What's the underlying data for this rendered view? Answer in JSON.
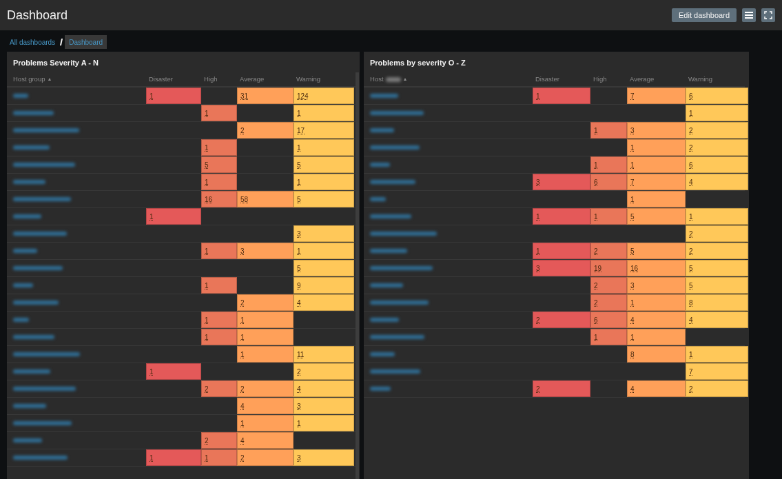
{
  "header": {
    "title": "Dashboard",
    "edit_button": "Edit dashboard"
  },
  "breadcrumbs": [
    {
      "label": "All dashboards",
      "selected": false
    },
    {
      "label": "Dashboard",
      "selected": true
    }
  ],
  "widgets": [
    {
      "title": "Problems Severity A - N",
      "host_label": "Host group",
      "host_label_blurred": false,
      "sort_icon": "▲",
      "columns": [
        {
          "label": "Disaster",
          "color": "#e45959"
        },
        {
          "label": "High",
          "color": "#e97659"
        },
        {
          "label": "Average",
          "color": "#ffa059"
        },
        {
          "label": "Warning",
          "color": "#ffc859"
        }
      ],
      "scrollbar": true,
      "rows": [
        {
          "cells": [
            "1",
            null,
            "31",
            "124"
          ]
        },
        {
          "cells": [
            null,
            "1",
            null,
            "1"
          ]
        },
        {
          "cells": [
            null,
            null,
            "2",
            "17"
          ]
        },
        {
          "cells": [
            null,
            "1",
            null,
            "1"
          ]
        },
        {
          "cells": [
            null,
            "5",
            null,
            "5"
          ]
        },
        {
          "cells": [
            null,
            "1",
            null,
            "1"
          ]
        },
        {
          "cells": [
            null,
            "16",
            "58",
            "5"
          ]
        },
        {
          "cells": [
            "1",
            null,
            null,
            null
          ]
        },
        {
          "cells": [
            null,
            null,
            null,
            "3"
          ]
        },
        {
          "cells": [
            null,
            "1",
            "3",
            "1"
          ]
        },
        {
          "cells": [
            null,
            null,
            null,
            "5"
          ]
        },
        {
          "cells": [
            null,
            "1",
            null,
            "9"
          ]
        },
        {
          "cells": [
            null,
            null,
            "2",
            "4"
          ]
        },
        {
          "cells": [
            null,
            "1",
            "1",
            null
          ]
        },
        {
          "cells": [
            null,
            "1",
            "1",
            null
          ]
        },
        {
          "cells": [
            null,
            null,
            "1",
            "11"
          ]
        },
        {
          "cells": [
            "1",
            null,
            null,
            "2"
          ]
        },
        {
          "cells": [
            null,
            "2",
            "2",
            "4"
          ]
        },
        {
          "cells": [
            null,
            null,
            "4",
            "3"
          ]
        },
        {
          "cells": [
            null,
            null,
            "1",
            "1"
          ]
        },
        {
          "cells": [
            null,
            "2",
            "4",
            null
          ]
        },
        {
          "cells": [
            "1",
            "1",
            "2",
            "3"
          ]
        }
      ]
    },
    {
      "title": "Problems by severity O - Z",
      "host_label": "Host",
      "host_label_blurred": true,
      "sort_icon": "▲",
      "columns": [
        {
          "label": "Disaster",
          "color": "#e45959"
        },
        {
          "label": "High",
          "color": "#e97659"
        },
        {
          "label": "Average",
          "color": "#ffa059"
        },
        {
          "label": "Warning",
          "color": "#ffc859"
        }
      ],
      "scrollbar": false,
      "rows": [
        {
          "cells": [
            "1",
            null,
            "7",
            "6"
          ]
        },
        {
          "cells": [
            null,
            null,
            null,
            "1"
          ]
        },
        {
          "cells": [
            null,
            "1",
            "3",
            "2"
          ]
        },
        {
          "cells": [
            null,
            null,
            "1",
            "2"
          ]
        },
        {
          "cells": [
            null,
            "1",
            "1",
            "6"
          ]
        },
        {
          "cells": [
            "3",
            "6",
            "7",
            "4"
          ]
        },
        {
          "cells": [
            null,
            null,
            "1",
            null
          ]
        },
        {
          "cells": [
            "1",
            "1",
            "5",
            "1"
          ]
        },
        {
          "cells": [
            null,
            null,
            null,
            "2"
          ]
        },
        {
          "cells": [
            "1",
            "2",
            "5",
            "2"
          ]
        },
        {
          "cells": [
            "3",
            "19",
            "16",
            "5"
          ]
        },
        {
          "cells": [
            null,
            "2",
            "3",
            "5"
          ]
        },
        {
          "cells": [
            null,
            "2",
            "1",
            "8"
          ]
        },
        {
          "cells": [
            "2",
            "6",
            "4",
            "4"
          ]
        },
        {
          "cells": [
            null,
            "1",
            "1",
            null
          ]
        },
        {
          "cells": [
            null,
            null,
            "8",
            "1"
          ]
        },
        {
          "cells": [
            null,
            null,
            null,
            "7"
          ]
        },
        {
          "cells": [
            "2",
            null,
            "4",
            "2"
          ]
        }
      ]
    }
  ]
}
